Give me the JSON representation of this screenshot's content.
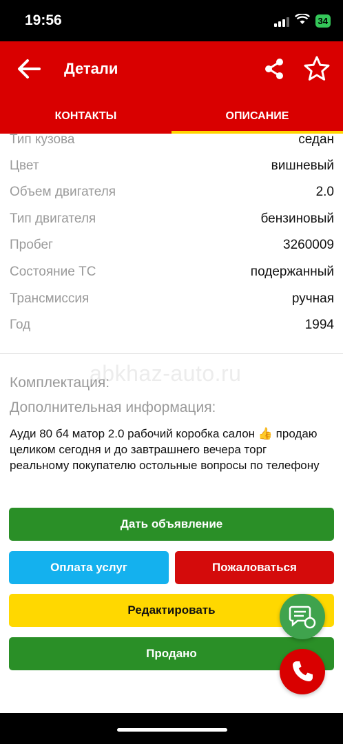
{
  "status_bar": {
    "time": "19:56",
    "battery": "34"
  },
  "header": {
    "title": "Детали"
  },
  "tabs": [
    {
      "label": "КОНТАКТЫ",
      "active": false
    },
    {
      "label": "ОПИСАНИЕ",
      "active": true
    }
  ],
  "specs": [
    {
      "label": "Тип кузова",
      "value": "седан"
    },
    {
      "label": "Цвет",
      "value": "вишневый"
    },
    {
      "label": "Объем двигателя",
      "value": "2.0"
    },
    {
      "label": "Тип двигателя",
      "value": "бензиновый"
    },
    {
      "label": "Пробег",
      "value": "3260009"
    },
    {
      "label": "Состояние ТС",
      "value": "подержанный"
    },
    {
      "label": "Трансмиссия",
      "value": "ручная"
    },
    {
      "label": "Год",
      "value": "1994"
    }
  ],
  "watermark": "abkhaz-auto.ru",
  "equipment_label": "Комплектация:",
  "extra_info_label": "Дополнительная информация:",
  "description": "Ауди 80 б4 матор 2.0 рабочий коробка салон 👍 продаю целиком сегодня и до завтрашнего вечера торг реальному покупателю остольные вопросы по телефону",
  "buttons": {
    "post_ad": "Дать объявление",
    "pay_services": "Оплата услуг",
    "report": "Пожаловаться",
    "edit": "Редактировать",
    "sold": "Продано"
  },
  "colors": {
    "brand_red": "#d90000",
    "tab_indicator": "#ffd400",
    "green": "#2a8f27",
    "blue": "#14b1ee",
    "yellow": "#ffd800"
  },
  "icons": [
    "back-arrow-icon",
    "share-icon",
    "star-outline-icon",
    "chat-icon",
    "phone-icon"
  ]
}
